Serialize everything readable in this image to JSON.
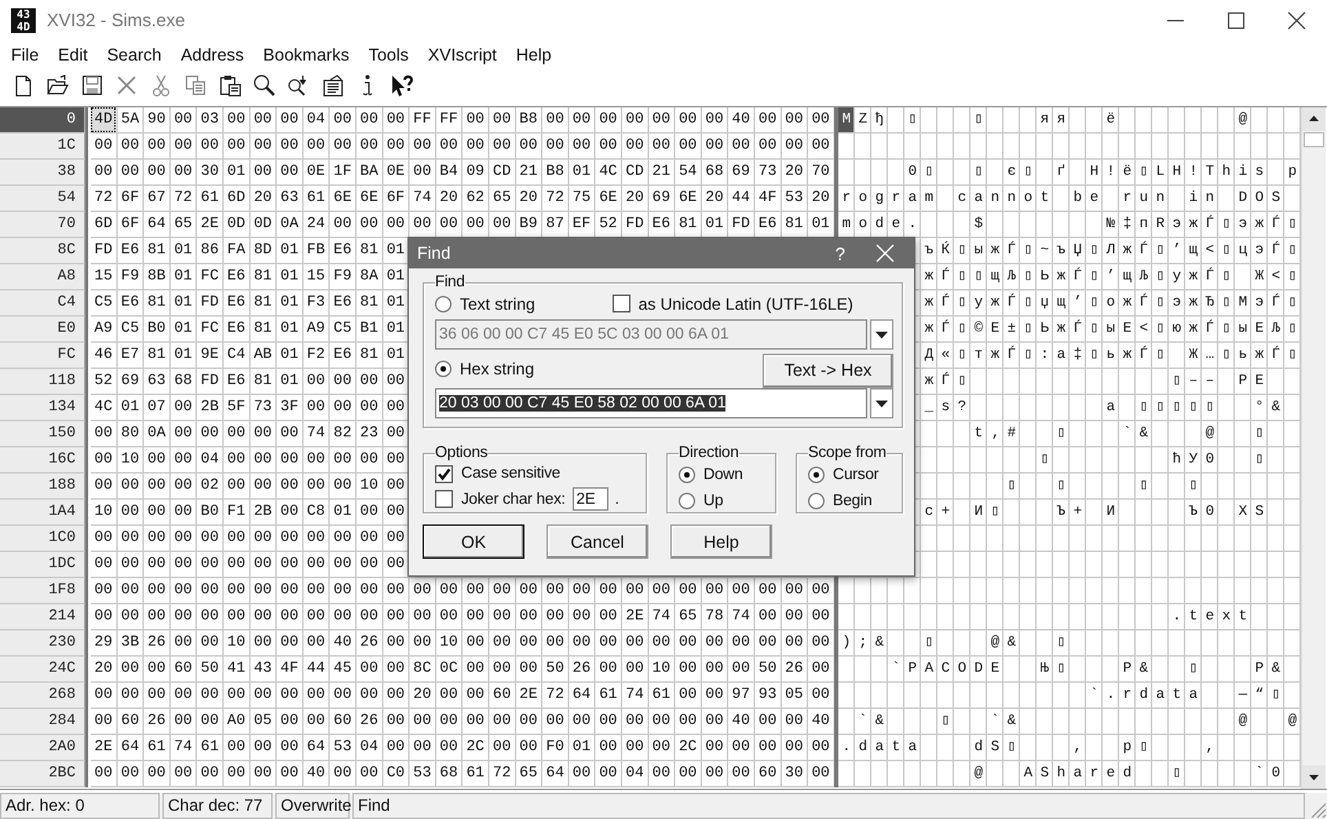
{
  "window": {
    "title": "XVI32 - Sims.exe",
    "app_icon": [
      "43",
      "4D"
    ]
  },
  "menu": [
    "File",
    "Edit",
    "Search",
    "Address",
    "Bookmarks",
    "Tools",
    "XVIscript",
    "Help"
  ],
  "rows": [
    {
      "address": "0",
      "selected": true,
      "hex": [
        "4D",
        "5A",
        "90",
        "00",
        "03",
        "00",
        "00",
        "00",
        "04",
        "00",
        "00",
        "00",
        "FF",
        "FF",
        "00",
        "00",
        "B8",
        "00",
        "00",
        "00",
        "00",
        "00",
        "00",
        "00",
        "40",
        "00",
        "00",
        "00"
      ],
      "chars": [
        {
          "char": "M"
        },
        {
          "char": "Z"
        },
        {
          "char": "ђ"
        },
        {
          "blank": true
        },
        {
          "char": "▯"
        },
        {
          "blank": true
        },
        {
          "blank": true
        },
        {
          "blank": true
        },
        {
          "char": "▯"
        },
        {
          "blank": true
        },
        {
          "blank": true
        },
        {
          "blank": true
        },
        {
          "char": "я"
        },
        {
          "char": "я"
        },
        {
          "blank": true
        },
        {
          "blank": true
        },
        {
          "char": "ё"
        },
        {
          "blank": true
        },
        {
          "blank": true
        },
        {
          "blank": true
        },
        {
          "blank": true
        },
        {
          "blank": true
        },
        {
          "blank": true
        },
        {
          "blank": true
        },
        {
          "char": "@"
        },
        {
          "blank": true
        },
        {
          "blank": true
        },
        {
          "blank": true
        }
      ]
    },
    {
      "address": "1C",
      "selected": false,
      "hex": [
        "00",
        "00",
        "00",
        "00",
        "00",
        "00",
        "00",
        "00",
        "00",
        "00",
        "00",
        "00",
        "00",
        "00",
        "00",
        "00",
        "00",
        "00",
        "00",
        "00",
        "00",
        "00",
        "00",
        "00",
        "00",
        "00",
        "00",
        "00"
      ]
    },
    {
      "address": "38",
      "selected": false,
      "hex": [
        "00",
        "00",
        "00",
        "00",
        "30",
        "01",
        "00",
        "00",
        "0E",
        "1F",
        "BA",
        "0E",
        "00",
        "B4",
        "09",
        "CD",
        "21",
        "B8",
        "01",
        "4C",
        "CD",
        "21",
        "54",
        "68",
        "69",
        "73",
        "20",
        "70"
      ],
      "chars": [
        {
          "blank": true
        },
        {
          "blank": true
        },
        {
          "blank": true
        },
        {
          "blank": true
        },
        {
          "char": "0"
        },
        {
          "char": "▯"
        },
        {
          "blank": true
        },
        {
          "blank": true
        },
        {
          "char": "▯"
        },
        {
          "blank": true
        },
        {
          "char": "є"
        },
        {
          "char": "▯"
        },
        {
          "blank": true
        },
        {
          "char": "ґ"
        },
        {
          "blank": true
        },
        {
          "char": "Н"
        },
        {
          "char": "!"
        },
        {
          "char": "ё"
        },
        {
          "char": "▯"
        },
        {
          "char": "L"
        },
        {
          "char": "Н"
        },
        {
          "char": "!"
        },
        {
          "char": "T"
        },
        {
          "char": "h"
        },
        {
          "char": "i"
        },
        {
          "char": "s"
        },
        {
          "blank": true
        },
        {
          "char": "p"
        }
      ]
    },
    {
      "address": "54",
      "selected": false,
      "hex": [
        "72",
        "6F",
        "67",
        "72",
        "61",
        "6D",
        "20",
        "63",
        "61",
        "6E",
        "6E",
        "6F",
        "74",
        "20",
        "62",
        "65",
        "20",
        "72",
        "75",
        "6E",
        "20",
        "69",
        "6E",
        "20",
        "44",
        "4F",
        "53",
        "20"
      ],
      "chars": [
        {
          "char": "r"
        },
        {
          "char": "o"
        },
        {
          "char": "g"
        },
        {
          "char": "r"
        },
        {
          "char": "a"
        },
        {
          "char": "m"
        },
        {
          "blank": true
        },
        {
          "char": "c"
        },
        {
          "char": "a"
        },
        {
          "char": "n"
        },
        {
          "char": "n"
        },
        {
          "char": "o"
        },
        {
          "char": "t"
        },
        {
          "blank": true
        },
        {
          "char": "b"
        },
        {
          "char": "e"
        },
        {
          "blank": true
        },
        {
          "char": "r"
        },
        {
          "char": "u"
        },
        {
          "char": "n"
        },
        {
          "blank": true
        },
        {
          "char": "i"
        },
        {
          "char": "n"
        },
        {
          "blank": true
        },
        {
          "char": "D"
        },
        {
          "char": "O"
        },
        {
          "char": "S"
        },
        {
          "blank": true
        }
      ]
    },
    {
      "address": "70",
      "selected": false,
      "hex": [
        "6D",
        "6F",
        "64",
        "65",
        "2E",
        "0D",
        "0D",
        "0A",
        "24",
        "00",
        "00",
        "00",
        "00",
        "00",
        "00",
        "00",
        "B9",
        "87",
        "EF",
        "52",
        "FD",
        "E6",
        "81",
        "01",
        "FD",
        "E6",
        "81",
        "01"
      ],
      "chars": [
        {
          "char": "m"
        },
        {
          "char": "o"
        },
        {
          "char": "d"
        },
        {
          "char": "e"
        },
        {
          "char": "."
        },
        {
          "blank": true
        },
        {
          "blank": true
        },
        {
          "blank": true
        },
        {
          "char": "$"
        },
        {
          "blank": true
        },
        {
          "blank": true
        },
        {
          "blank": true
        },
        {
          "blank": true
        },
        {
          "blank": true
        },
        {
          "blank": true
        },
        {
          "blank": true
        },
        {
          "char": "№"
        },
        {
          "char": "‡"
        },
        {
          "char": "п"
        },
        {
          "char": "R"
        },
        {
          "char": "э"
        },
        {
          "char": "ж"
        },
        {
          "char": "Ѓ"
        },
        {
          "char": "▯"
        },
        {
          "char": "э"
        },
        {
          "char": "ж"
        },
        {
          "char": "Ѓ"
        },
        {
          "char": "▯"
        }
      ]
    },
    {
      "address": "8C",
      "selected": false,
      "hex": [
        "FD",
        "E6",
        "81",
        "01",
        "86",
        "FA",
        "8D",
        "01",
        "FB",
        "E6",
        "81",
        "01"
      ],
      "chars": [
        {
          "char": "ъ"
        },
        {
          "char": "Ќ"
        },
        {
          "char": "▯"
        },
        {
          "char": "ы"
        },
        {
          "char": "ж"
        },
        {
          "char": "Ѓ"
        },
        {
          "char": "▯"
        },
        {
          "char": "~"
        },
        {
          "char": "ъ"
        },
        {
          "char": "Џ"
        },
        {
          "char": "▯"
        },
        {
          "char": "Л"
        },
        {
          "char": "ж"
        },
        {
          "char": "Ѓ"
        },
        {
          "char": "▯"
        },
        {
          "char": "’"
        },
        {
          "char": "щ"
        },
        {
          "char": "<"
        },
        {
          "char": "▯"
        },
        {
          "char": "ц"
        },
        {
          "char": "э"
        },
        {
          "char": "Ѓ"
        },
        {
          "char": "▯"
        }
      ]
    },
    {
      "address": "A8",
      "selected": false,
      "hex": [
        "15",
        "F9",
        "8B",
        "01",
        "FC",
        "E6",
        "81",
        "01",
        "15",
        "F9",
        "8A",
        "01"
      ],
      "chars": [
        {
          "char": "ж"
        },
        {
          "char": "Ѓ"
        },
        {
          "char": "▯"
        },
        {
          "char": "▯"
        },
        {
          "char": "щ"
        },
        {
          "char": "Љ"
        },
        {
          "char": "▯"
        },
        {
          "char": "Ь"
        },
        {
          "char": "ж"
        },
        {
          "char": "Ѓ"
        },
        {
          "char": "▯"
        },
        {
          "char": "’"
        },
        {
          "char": "щ"
        },
        {
          "char": "Љ"
        },
        {
          "char": "▯"
        },
        {
          "char": "у"
        },
        {
          "char": "ж"
        },
        {
          "char": "Ѓ"
        },
        {
          "char": "▯"
        },
        {
          "blank": true
        },
        {
          "char": "Ж"
        },
        {
          "char": "<"
        },
        {
          "char": "▯"
        }
      ]
    },
    {
      "address": "C4",
      "selected": false,
      "hex": [
        "C5",
        "E6",
        "81",
        "01",
        "FD",
        "E6",
        "81",
        "01",
        "F3",
        "E6",
        "81",
        "01"
      ],
      "chars": [
        {
          "char": "ж"
        },
        {
          "char": "Ѓ"
        },
        {
          "char": "▯"
        },
        {
          "char": "у"
        },
        {
          "char": "ж"
        },
        {
          "char": "Ѓ"
        },
        {
          "char": "▯"
        },
        {
          "char": "џ"
        },
        {
          "char": "щ"
        },
        {
          "char": "’"
        },
        {
          "char": "▯"
        },
        {
          "char": "о"
        },
        {
          "char": "ж"
        },
        {
          "char": "Ѓ"
        },
        {
          "char": "▯"
        },
        {
          "char": "э"
        },
        {
          "char": "ж"
        },
        {
          "char": "Ђ"
        },
        {
          "char": "▯"
        },
        {
          "char": "М"
        },
        {
          "char": "э"
        },
        {
          "char": "Ѓ"
        },
        {
          "char": "▯"
        }
      ]
    },
    {
      "address": "E0",
      "selected": false,
      "hex": [
        "A9",
        "C5",
        "B0",
        "01",
        "FC",
        "E6",
        "81",
        "01",
        "A9",
        "C5",
        "B1",
        "01"
      ],
      "chars": [
        {
          "char": "ж"
        },
        {
          "char": "Ѓ"
        },
        {
          "char": "▯"
        },
        {
          "char": "©"
        },
        {
          "char": "Е"
        },
        {
          "char": "±"
        },
        {
          "char": "▯"
        },
        {
          "char": "Ь"
        },
        {
          "char": "ж"
        },
        {
          "char": "Ѓ"
        },
        {
          "char": "▯"
        },
        {
          "char": "ы"
        },
        {
          "char": "Е"
        },
        {
          "char": "<"
        },
        {
          "char": "▯"
        },
        {
          "char": "ю"
        },
        {
          "char": "ж"
        },
        {
          "char": "Ѓ"
        },
        {
          "char": "▯"
        },
        {
          "char": "ы"
        },
        {
          "char": "Е"
        },
        {
          "char": "Љ"
        },
        {
          "char": "▯"
        }
      ]
    },
    {
      "address": "FC",
      "selected": false,
      "hex": [
        "46",
        "E7",
        "81",
        "01",
        "9E",
        "C4",
        "AB",
        "01",
        "F2",
        "E6",
        "81",
        "01"
      ],
      "chars": [
        {
          "char": "Д"
        },
        {
          "char": "«"
        },
        {
          "char": "▯"
        },
        {
          "char": "т"
        },
        {
          "char": "ж"
        },
        {
          "char": "Ѓ"
        },
        {
          "char": "▯"
        },
        {
          "char": ":"
        },
        {
          "char": "а"
        },
        {
          "char": "‡"
        },
        {
          "char": "▯"
        },
        {
          "char": "ь"
        },
        {
          "char": "ж"
        },
        {
          "char": "Ѓ"
        },
        {
          "char": "▯"
        },
        {
          "blank": true
        },
        {
          "char": "Ж"
        },
        {
          "char": "…"
        },
        {
          "char": "▯"
        },
        {
          "char": "ь"
        },
        {
          "char": "ж"
        },
        {
          "char": "Ѓ"
        },
        {
          "char": "▯"
        }
      ]
    },
    {
      "address": "118",
      "selected": false,
      "hex": [
        "52",
        "69",
        "63",
        "68",
        "FD",
        "E6",
        "81",
        "01",
        "00",
        "00",
        "00",
        "00"
      ],
      "chars": [
        {
          "char": "ж"
        },
        {
          "char": "Ѓ"
        },
        {
          "char": "▯"
        },
        {
          "blank": true
        },
        {
          "blank": true
        },
        {
          "blank": true
        },
        {
          "blank": true
        },
        {
          "blank": true
        },
        {
          "blank": true
        },
        {
          "blank": true
        },
        {
          "blank": true
        },
        {
          "blank": true
        },
        {
          "blank": true
        },
        {
          "blank": true
        },
        {
          "blank": true
        },
        {
          "char": "▯"
        },
        {
          "char": "–"
        },
        {
          "char": "–"
        },
        {
          "blank": true
        },
        {
          "char": "P"
        },
        {
          "char": "E"
        },
        {
          "blank": true
        },
        {
          "blank": true
        }
      ]
    },
    {
      "address": "134",
      "selected": false,
      "hex": [
        "4C",
        "01",
        "07",
        "00",
        "2B",
        "5F",
        "73",
        "3F",
        "00",
        "00",
        "00",
        "00"
      ],
      "chars": [
        {
          "char": "_"
        },
        {
          "char": "s"
        },
        {
          "char": "?"
        },
        {
          "blank": true
        },
        {
          "blank": true
        },
        {
          "blank": true
        },
        {
          "blank": true
        },
        {
          "blank": true
        },
        {
          "blank": true
        },
        {
          "blank": true
        },
        {
          "blank": true
        },
        {
          "char": "а"
        },
        {
          "blank": true
        },
        {
          "char": "▯"
        },
        {
          "char": "▯"
        },
        {
          "char": "▯"
        },
        {
          "char": "▯"
        },
        {
          "char": "▯"
        },
        {
          "blank": true
        },
        {
          "blank": true
        },
        {
          "char": "°"
        },
        {
          "char": "&"
        },
        {
          "blank": true
        }
      ]
    },
    {
      "address": "150",
      "selected": false,
      "hex": [
        "00",
        "80",
        "0A",
        "00",
        "00",
        "00",
        "00",
        "00",
        "74",
        "82",
        "23",
        "00"
      ],
      "chars": [
        {
          "blank": true
        },
        {
          "blank": true
        },
        {
          "blank": true
        },
        {
          "char": "t"
        },
        {
          "char": "‚"
        },
        {
          "char": "#"
        },
        {
          "blank": true
        },
        {
          "blank": true
        },
        {
          "char": "▯"
        },
        {
          "blank": true
        },
        {
          "blank": true
        },
        {
          "blank": true
        },
        {
          "char": "`"
        },
        {
          "char": "&"
        },
        {
          "blank": true
        },
        {
          "blank": true
        },
        {
          "blank": true
        },
        {
          "char": "@"
        },
        {
          "blank": true
        },
        {
          "blank": true
        },
        {
          "char": "▯"
        },
        {
          "blank": true
        },
        {
          "blank": true
        }
      ]
    },
    {
      "address": "16C",
      "selected": false,
      "hex": [
        "00",
        "10",
        "00",
        "00",
        "04",
        "00",
        "00",
        "00",
        "00",
        "00",
        "00",
        "00"
      ],
      "chars": [
        {
          "blank": true
        },
        {
          "blank": true
        },
        {
          "blank": true
        },
        {
          "blank": true
        },
        {
          "blank": true
        },
        {
          "blank": true
        },
        {
          "blank": true
        },
        {
          "char": "▯"
        },
        {
          "blank": true
        },
        {
          "blank": true
        },
        {
          "blank": true
        },
        {
          "blank": true
        },
        {
          "blank": true
        },
        {
          "blank": true
        },
        {
          "blank": true
        },
        {
          "char": "ћ"
        },
        {
          "char": "У"
        },
        {
          "char": "0"
        },
        {
          "blank": true
        },
        {
          "blank": true
        },
        {
          "char": "▯"
        },
        {
          "blank": true
        },
        {
          "blank": true
        }
      ]
    },
    {
      "address": "188",
      "selected": false,
      "hex": [
        "00",
        "00",
        "00",
        "00",
        "02",
        "00",
        "00",
        "00",
        "00",
        "00",
        "10",
        "00"
      ],
      "chars": [
        {
          "blank": true
        },
        {
          "blank": true
        },
        {
          "blank": true
        },
        {
          "blank": true
        },
        {
          "blank": true
        },
        {
          "char": "▯"
        },
        {
          "blank": true
        },
        {
          "blank": true
        },
        {
          "char": "▯"
        },
        {
          "blank": true
        },
        {
          "blank": true
        },
        {
          "blank": true
        },
        {
          "blank": true
        },
        {
          "char": "▯"
        },
        {
          "blank": true
        },
        {
          "blank": true
        },
        {
          "char": "▯"
        },
        {
          "blank": true
        },
        {
          "blank": true
        },
        {
          "blank": true
        },
        {
          "blank": true
        },
        {
          "blank": true
        },
        {
          "blank": true
        }
      ]
    },
    {
      "address": "1A4",
      "selected": false,
      "hex": [
        "10",
        "00",
        "00",
        "00",
        "B0",
        "F1",
        "2B",
        "00",
        "C8",
        "01",
        "00",
        "00"
      ],
      "chars": [
        {
          "char": "с"
        },
        {
          "char": "+"
        },
        {
          "blank": true
        },
        {
          "char": "И"
        },
        {
          "char": "▯"
        },
        {
          "blank": true
        },
        {
          "blank": true
        },
        {
          "blank": true
        },
        {
          "char": "Ъ"
        },
        {
          "char": "+"
        },
        {
          "blank": true
        },
        {
          "char": "И"
        },
        {
          "blank": true
        },
        {
          "blank": true
        },
        {
          "blank": true
        },
        {
          "blank": true
        },
        {
          "char": "Ъ"
        },
        {
          "char": "0"
        },
        {
          "blank": true
        },
        {
          "char": "X"
        },
        {
          "char": "S"
        },
        {
          "blank": true
        },
        {
          "blank": true
        }
      ]
    },
    {
      "address": "1C0",
      "selected": false,
      "hex": [
        "00",
        "00",
        "00",
        "00",
        "00",
        "00",
        "00",
        "00",
        "00",
        "00",
        "00",
        "00"
      ]
    },
    {
      "address": "1DC",
      "selected": false,
      "hex": [
        "00",
        "00",
        "00",
        "00",
        "00",
        "00",
        "00",
        "00",
        "00",
        "00",
        "00",
        "00"
      ]
    },
    {
      "address": "1F8",
      "selected": false,
      "hex": [
        "00",
        "00",
        "00",
        "00",
        "00",
        "00",
        "00",
        "00",
        "00",
        "00",
        "00",
        "00",
        "00",
        "00",
        "00",
        "00",
        "00",
        "00",
        "00",
        "00",
        "00",
        "00",
        "00",
        "00",
        "00",
        "00",
        "00",
        "00"
      ]
    },
    {
      "address": "214",
      "selected": false,
      "hex": [
        "00",
        "00",
        "00",
        "00",
        "00",
        "00",
        "00",
        "00",
        "00",
        "00",
        "00",
        "00",
        "00",
        "00",
        "00",
        "00",
        "00",
        "00",
        "00",
        "00",
        "2E",
        "74",
        "65",
        "78",
        "74",
        "00",
        "00",
        "00"
      ],
      "chars": [
        {
          "blank": true
        },
        {
          "blank": true
        },
        {
          "blank": true
        },
        {
          "blank": true
        },
        {
          "blank": true
        },
        {
          "blank": true
        },
        {
          "blank": true
        },
        {
          "blank": true
        },
        {
          "blank": true
        },
        {
          "blank": true
        },
        {
          "blank": true
        },
        {
          "blank": true
        },
        {
          "blank": true
        },
        {
          "blank": true
        },
        {
          "blank": true
        },
        {
          "blank": true
        },
        {
          "blank": true
        },
        {
          "blank": true
        },
        {
          "blank": true
        },
        {
          "blank": true
        },
        {
          "char": "."
        },
        {
          "char": "t"
        },
        {
          "char": "e"
        },
        {
          "char": "x"
        },
        {
          "char": "t"
        },
        {
          "blank": true
        },
        {
          "blank": true
        },
        {
          "blank": true
        }
      ]
    },
    {
      "address": "230",
      "selected": false,
      "hex": [
        "29",
        "3B",
        "26",
        "00",
        "00",
        "10",
        "00",
        "00",
        "00",
        "40",
        "26",
        "00",
        "00",
        "10",
        "00",
        "00",
        "00",
        "00",
        "00",
        "00",
        "00",
        "00",
        "00",
        "00",
        "00",
        "00",
        "00",
        "00"
      ],
      "chars": [
        {
          "char": ")"
        },
        {
          "char": ";"
        },
        {
          "char": "&"
        },
        {
          "blank": true
        },
        {
          "blank": true
        },
        {
          "char": "▯"
        },
        {
          "blank": true
        },
        {
          "blank": true
        },
        {
          "blank": true
        },
        {
          "char": "@"
        },
        {
          "char": "&"
        },
        {
          "blank": true
        },
        {
          "blank": true
        },
        {
          "char": "▯"
        },
        {
          "blank": true
        },
        {
          "blank": true
        },
        {
          "blank": true
        },
        {
          "blank": true
        },
        {
          "blank": true
        },
        {
          "blank": true
        },
        {
          "blank": true
        },
        {
          "blank": true
        },
        {
          "blank": true
        },
        {
          "blank": true
        },
        {
          "blank": true
        },
        {
          "blank": true
        },
        {
          "blank": true
        },
        {
          "blank": true
        }
      ]
    },
    {
      "address": "24C",
      "selected": false,
      "hex": [
        "20",
        "00",
        "00",
        "60",
        "50",
        "41",
        "43",
        "4F",
        "44",
        "45",
        "00",
        "00",
        "8C",
        "0C",
        "00",
        "00",
        "00",
        "50",
        "26",
        "00",
        "00",
        "10",
        "00",
        "00",
        "00",
        "50",
        "26",
        "00"
      ],
      "chars": [
        {
          "blank": true
        },
        {
          "blank": true
        },
        {
          "blank": true
        },
        {
          "char": "`"
        },
        {
          "char": "P"
        },
        {
          "char": "A"
        },
        {
          "char": "C"
        },
        {
          "char": "O"
        },
        {
          "char": "D"
        },
        {
          "char": "E"
        },
        {
          "blank": true
        },
        {
          "blank": true
        },
        {
          "char": "Њ"
        },
        {
          "char": "▯"
        },
        {
          "blank": true
        },
        {
          "blank": true
        },
        {
          "blank": true
        },
        {
          "char": "P"
        },
        {
          "char": "&"
        },
        {
          "blank": true
        },
        {
          "blank": true
        },
        {
          "char": "▯"
        },
        {
          "blank": true
        },
        {
          "blank": true
        },
        {
          "blank": true
        },
        {
          "char": "P"
        },
        {
          "char": "&"
        },
        {
          "blank": true
        }
      ]
    },
    {
      "address": "268",
      "selected": false,
      "hex": [
        "00",
        "00",
        "00",
        "00",
        "00",
        "00",
        "00",
        "00",
        "00",
        "00",
        "00",
        "00",
        "20",
        "00",
        "00",
        "60",
        "2E",
        "72",
        "64",
        "61",
        "74",
        "61",
        "00",
        "00",
        "97",
        "93",
        "05",
        "00"
      ],
      "chars": [
        {
          "blank": true
        },
        {
          "blank": true
        },
        {
          "blank": true
        },
        {
          "blank": true
        },
        {
          "blank": true
        },
        {
          "blank": true
        },
        {
          "blank": true
        },
        {
          "blank": true
        },
        {
          "blank": true
        },
        {
          "blank": true
        },
        {
          "blank": true
        },
        {
          "blank": true
        },
        {
          "blank": true
        },
        {
          "blank": true
        },
        {
          "blank": true
        },
        {
          "char": "`"
        },
        {
          "char": "."
        },
        {
          "char": "r"
        },
        {
          "char": "d"
        },
        {
          "char": "a"
        },
        {
          "char": "t"
        },
        {
          "char": "a"
        },
        {
          "blank": true
        },
        {
          "blank": true
        },
        {
          "char": "—"
        },
        {
          "char": "“"
        },
        {
          "char": "▯"
        },
        {
          "blank": true
        }
      ]
    },
    {
      "address": "284",
      "selected": false,
      "hex": [
        "00",
        "60",
        "26",
        "00",
        "00",
        "A0",
        "05",
        "00",
        "00",
        "60",
        "26",
        "00",
        "00",
        "00",
        "00",
        "00",
        "00",
        "00",
        "00",
        "00",
        "00",
        "00",
        "00",
        "00",
        "40",
        "00",
        "00",
        "40"
      ],
      "chars": [
        {
          "blank": true
        },
        {
          "char": "`"
        },
        {
          "char": "&"
        },
        {
          "blank": true
        },
        {
          "blank": true
        },
        {
          "blank": true
        },
        {
          "char": "▯"
        },
        {
          "blank": true
        },
        {
          "blank": true
        },
        {
          "char": "`"
        },
        {
          "char": "&"
        },
        {
          "blank": true
        },
        {
          "blank": true
        },
        {
          "blank": true
        },
        {
          "blank": true
        },
        {
          "blank": true
        },
        {
          "blank": true
        },
        {
          "blank": true
        },
        {
          "blank": true
        },
        {
          "blank": true
        },
        {
          "blank": true
        },
        {
          "blank": true
        },
        {
          "blank": true
        },
        {
          "blank": true
        },
        {
          "char": "@"
        },
        {
          "blank": true
        },
        {
          "blank": true
        },
        {
          "char": "@"
        }
      ]
    },
    {
      "address": "2A0",
      "selected": false,
      "hex": [
        "2E",
        "64",
        "61",
        "74",
        "61",
        "00",
        "00",
        "00",
        "64",
        "53",
        "04",
        "00",
        "00",
        "00",
        "2C",
        "00",
        "00",
        "F0",
        "01",
        "00",
        "00",
        "00",
        "2C",
        "00",
        "00",
        "00",
        "00",
        "00"
      ],
      "chars": [
        {
          "char": "."
        },
        {
          "char": "d"
        },
        {
          "char": "a"
        },
        {
          "char": "t"
        },
        {
          "char": "a"
        },
        {
          "blank": true
        },
        {
          "blank": true
        },
        {
          "blank": true
        },
        {
          "char": "d"
        },
        {
          "char": "S"
        },
        {
          "char": "▯"
        },
        {
          "blank": true
        },
        {
          "blank": true
        },
        {
          "blank": true
        },
        {
          "char": ","
        },
        {
          "blank": true
        },
        {
          "blank": true
        },
        {
          "char": "р"
        },
        {
          "char": "▯"
        },
        {
          "blank": true
        },
        {
          "blank": true
        },
        {
          "blank": true
        },
        {
          "char": ","
        },
        {
          "blank": true
        },
        {
          "blank": true
        },
        {
          "blank": true
        },
        {
          "blank": true
        },
        {
          "blank": true
        }
      ]
    },
    {
      "address": "2BC",
      "selected": false,
      "hex": [
        "00",
        "00",
        "00",
        "00",
        "00",
        "00",
        "00",
        "00",
        "40",
        "00",
        "00",
        "C0",
        "53",
        "68",
        "61",
        "72",
        "65",
        "64",
        "00",
        "00",
        "04",
        "00",
        "00",
        "00",
        "00",
        "60",
        "30",
        "00"
      ],
      "chars": [
        {
          "blank": true
        },
        {
          "blank": true
        },
        {
          "blank": true
        },
        {
          "blank": true
        },
        {
          "blank": true
        },
        {
          "blank": true
        },
        {
          "blank": true
        },
        {
          "blank": true
        },
        {
          "char": "@"
        },
        {
          "blank": true
        },
        {
          "blank": true
        },
        {
          "char": "А"
        },
        {
          "char": "S"
        },
        {
          "char": "h"
        },
        {
          "char": "a"
        },
        {
          "char": "r"
        },
        {
          "char": "e"
        },
        {
          "char": "d"
        },
        {
          "blank": true
        },
        {
          "blank": true
        },
        {
          "char": "▯"
        },
        {
          "blank": true
        },
        {
          "blank": true
        },
        {
          "blank": true
        },
        {
          "blank": true
        },
        {
          "char": "`"
        },
        {
          "char": "0"
        },
        {
          "blank": true
        }
      ]
    }
  ],
  "find_dialog": {
    "title": "Find",
    "help_button": "?",
    "find_group": {
      "label": "Find",
      "text_string": {
        "label": "Text string",
        "selected": false
      },
      "unicode_latin": {
        "label": "as Unicode Latin (UTF-16LE)",
        "checked": false
      },
      "text_field": {
        "value": "36 06 00 00 C7 45 E0 5C 03 00 00 6A 01",
        "disabled": true
      },
      "hex_string": {
        "label": "Hex string",
        "selected": true
      },
      "text_to_hex_button": "Text -> Hex",
      "hex_field": {
        "value": "20 03 00 00 C7 45 E0 58 02 00 00 6A 01",
        "highlighted": true
      }
    },
    "options": {
      "label": "Options",
      "case_sensitive": {
        "label": "Case sensitive",
        "checked": true
      },
      "joker_char": {
        "label": "Joker char hex:",
        "checked": false,
        "value": "2E",
        "suffix": "."
      }
    },
    "direction": {
      "label": "Direction",
      "choices": [
        {
          "label": "Down",
          "selected": true
        },
        {
          "label": "Up",
          "selected": false
        }
      ]
    },
    "scope": {
      "label": "Scope from",
      "choices": [
        {
          "label": "Cursor",
          "selected": true
        },
        {
          "label": "Begin",
          "selected": false
        }
      ]
    },
    "buttons": [
      {
        "label": "OK",
        "default": true
      },
      {
        "label": "Cancel",
        "default": false
      },
      {
        "label": "Help",
        "default": false
      }
    ]
  },
  "status_bar": [
    "Adr. hex: 0",
    "Char dec: 77",
    "Overwrite",
    "Find"
  ]
}
